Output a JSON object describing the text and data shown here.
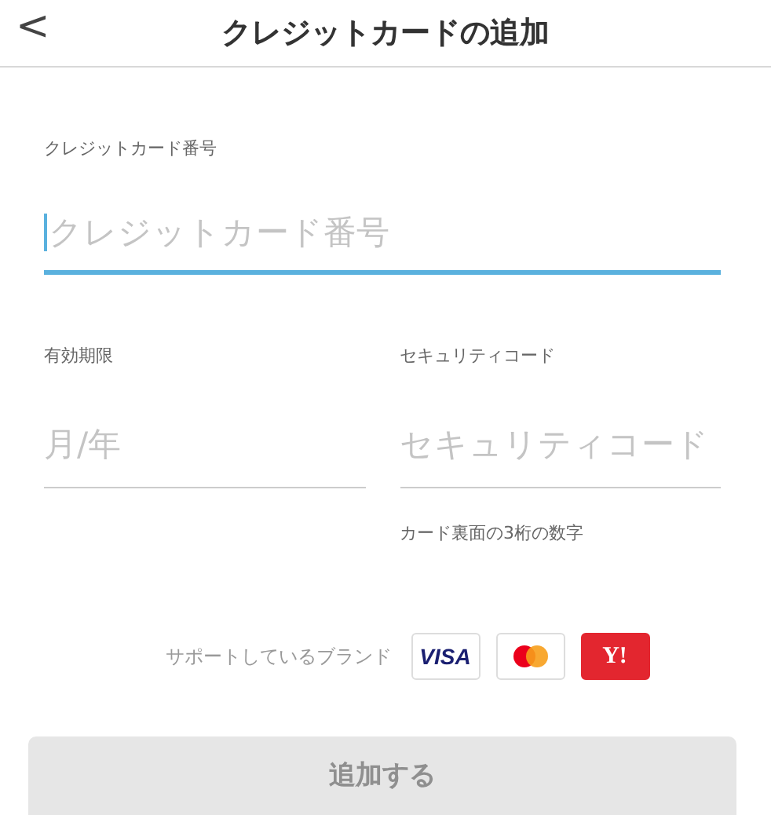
{
  "header": {
    "back": "<",
    "title": "クレジットカードの追加"
  },
  "card_number": {
    "label": "クレジットカード番号",
    "placeholder": "クレジットカード番号",
    "focused": true
  },
  "fields": [
    {
      "label": "有効期限",
      "placeholder": "月/年",
      "focused": false
    },
    {
      "label": "セキュリティコード",
      "placeholder": "セキュリティコード",
      "focused": false,
      "hint": "カード裏面の3桁の数字"
    }
  ],
  "brands": {
    "label": "サポートしているブランド",
    "items": [
      {
        "kind": "visa",
        "text": "VISA"
      },
      {
        "kind": "mastercard"
      },
      {
        "kind": "yahoo",
        "text": "Y!"
      }
    ]
  },
  "submit": {
    "label": "追加する",
    "disabled": true
  }
}
